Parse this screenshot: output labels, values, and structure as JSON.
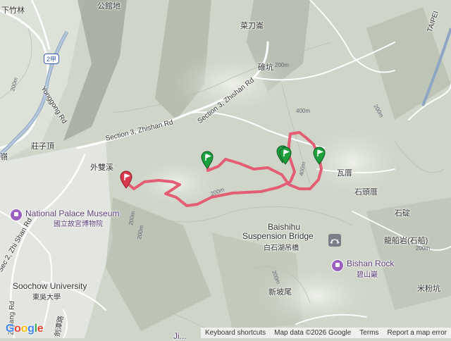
{
  "map": {
    "colors": {
      "terrain": "#cfd6c9",
      "ridge_dark": "#9aa396",
      "ridge_light": "#e9ede4",
      "road": "#ffffff",
      "highway": "#8ea6c4",
      "route": "#e35d74",
      "pin_green": "#1e9f3e",
      "pin_red": "#d8394a",
      "poi": "#9b5fc0"
    },
    "labels": {
      "top_left": "下竹林",
      "top_center": "公館地",
      "caidao": "菜刀崙",
      "beikeng": "碓坑",
      "wai_shuang_xi": "外雙溪",
      "zhuangziding": "莊子頂",
      "left_edge": "嶺",
      "wa_cuo": "瓦厝",
      "shi_tou_cuo": "石頭厝",
      "shi_ding": "石碇",
      "long_chuan_yan": "龍船岩(石船)",
      "mi_fen_keng": "米粉坑",
      "xin_po_wei": "新坡尾"
    },
    "pois": {
      "palace_en": "National Palace Museum",
      "palace_zh": "國立故宮博物院",
      "bridge_en": "Baishihu",
      "bridge_en2": "Suspension Bridge",
      "bridge_zh": "白石湖吊橋",
      "rock_en": "Bishan Rock",
      "rock_zh": "碧山巖",
      "soochow_en": "Soochow University",
      "soochow_zh": "東吳大學",
      "bottom_poi": "Ji..."
    },
    "roads": {
      "yonggong": "Yonggong Rd",
      "zhishan_3": "Section 3, Zhishan Rd",
      "zhishan_3b": "Section 3, Zhishan Rd",
      "zhishan_2": "Sec 2, Zhi Shan Rd",
      "zhiqing": "Ziqiang Rd",
      "taipei": "TAIPEI",
      "jian_tan": "劍潭路",
      "route_2": "2甲"
    },
    "contours": [
      "200m",
      "200m",
      "200m",
      "200m",
      "400m",
      "200m",
      "200m",
      "200m",
      "200m",
      "400m"
    ],
    "logo": "Google",
    "attribution": {
      "keyboard": "Keyboard shortcuts",
      "data": "Map data ©2026 Google",
      "terms": "Terms",
      "report": "Report a map error"
    }
  }
}
